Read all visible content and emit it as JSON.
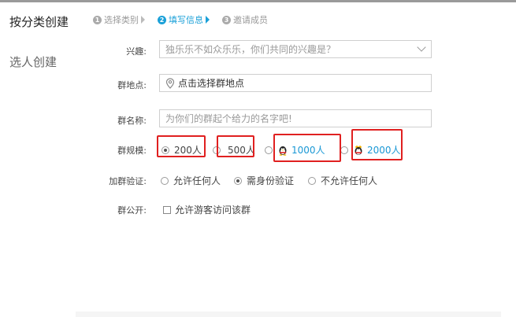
{
  "left": {
    "title": "按分类创建",
    "alt": "选人创建"
  },
  "steps": [
    {
      "num": "1",
      "label": "选择类别"
    },
    {
      "num": "2",
      "label": "填写信息"
    },
    {
      "num": "3",
      "label": "邀请成员"
    }
  ],
  "form": {
    "interest": {
      "label": "兴趣:",
      "placeholder": "独乐乐不如众乐乐，你们共同的兴趣是？"
    },
    "location": {
      "label": "群地点:",
      "value": "点击选择群地点"
    },
    "name": {
      "label": "群名称:",
      "placeholder": "为你们的群起个给力的名字吧!"
    },
    "size": {
      "label": "群规模:",
      "options": [
        "200人",
        "500人",
        "1000人",
        "2000人"
      ],
      "selected": "200人"
    },
    "verify": {
      "label": "加群验证:",
      "options": [
        "允许任何人",
        "需身份验证",
        "不允许任何人"
      ],
      "selected": "需身份验证"
    },
    "public": {
      "label": "群公开:",
      "checkbox": "允许游客访问该群"
    }
  },
  "colors": {
    "accent": "#1aa0d8",
    "highlight": "#e02020"
  }
}
